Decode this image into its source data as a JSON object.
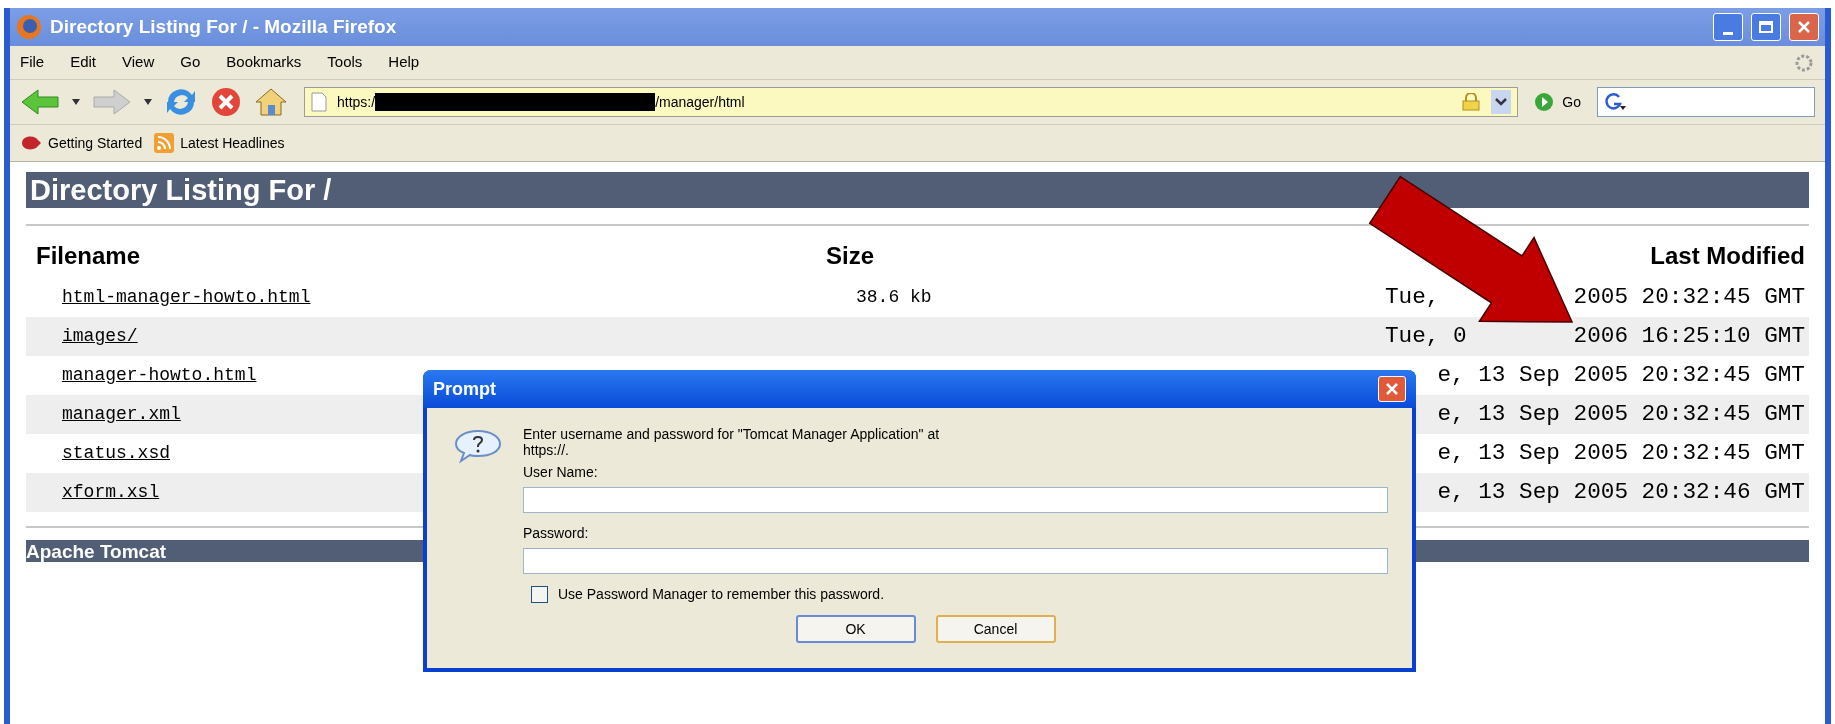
{
  "window": {
    "title": "Directory Listing For / - Mozilla Firefox"
  },
  "menu": [
    "File",
    "Edit",
    "View",
    "Go",
    "Bookmarks",
    "Tools",
    "Help"
  ],
  "address_bar": {
    "prefix": "https:/",
    "suffix": "/manager/html"
  },
  "go_button": "Go",
  "bookmarks": [
    "Getting Started",
    "Latest Headlines"
  ],
  "page": {
    "heading": "Directory Listing For /",
    "columns": [
      "Filename",
      "Size",
      "Last Modified"
    ],
    "rows": [
      {
        "filename": "html-manager-howto.html",
        "size": "38.6 kb",
        "modified": [
          "Tue,",
          "2005 20:32:45 GMT"
        ]
      },
      {
        "filename": "images/",
        "modified": [
          "Tue, 0",
          "2006 16:25:10 GMT"
        ]
      },
      {
        "filename": "manager-howto.html",
        "modified": [
          "e, 13 Sep 2005 20:32:45 GMT"
        ]
      },
      {
        "filename": "manager.xml",
        "modified": [
          "e, 13 Sep 2005 20:32:45 GMT"
        ]
      },
      {
        "filename": "status.xsd",
        "modified": [
          "e, 13 Sep 2005 20:32:45 GMT"
        ]
      },
      {
        "filename": "xform.xsl",
        "modified": [
          "e, 13 Sep 2005 20:32:46 GMT"
        ]
      }
    ],
    "footer": "Apache Tomcat"
  },
  "dialog": {
    "title": "Prompt",
    "message": "Enter username and password for \"Tomcat Manager Application\" at",
    "url": "https://.",
    "username_label": "User Name:",
    "password_label": "Password:",
    "remember": {
      "label": "Use Password Manager to remember this password.",
      "checked": false
    },
    "buttons": [
      "OK",
      "Cancel"
    ]
  }
}
